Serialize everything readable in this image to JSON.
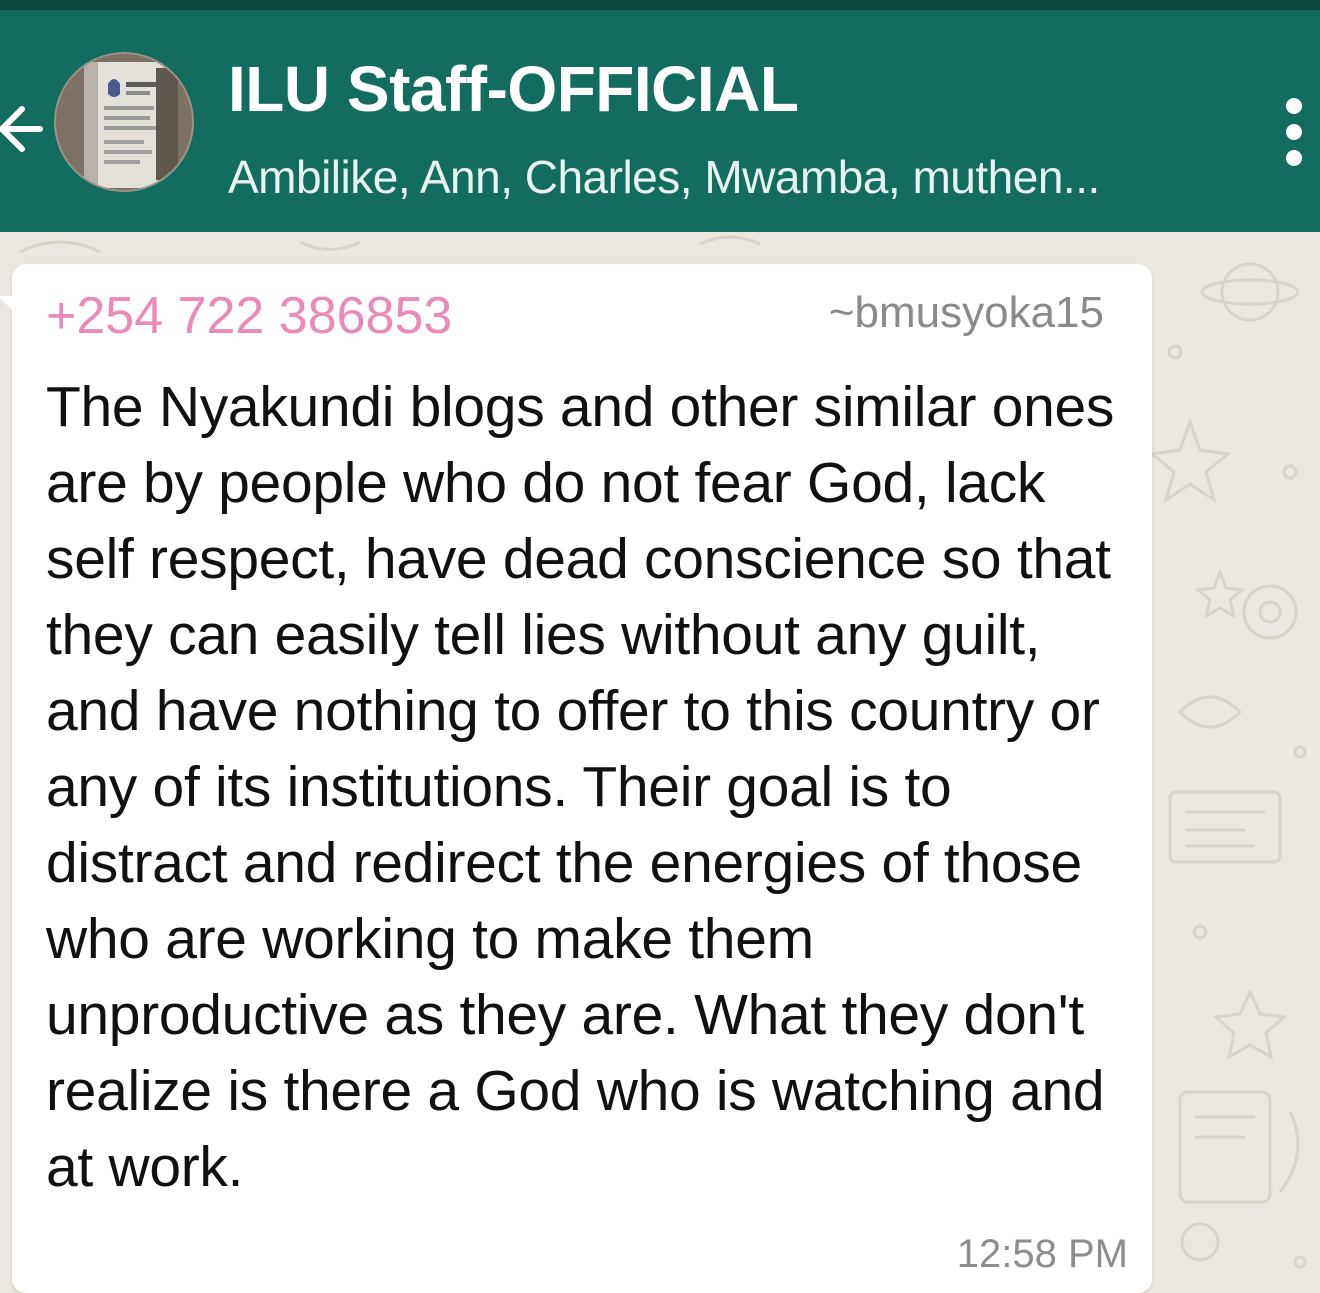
{
  "colors": {
    "header": "#136d5f",
    "status_bar": "#0d4a40",
    "chat_background": "#ebe6df",
    "bubble": "#ffffff",
    "sender_phone": "#e98ab8",
    "timestamp": "#8d8d8d"
  },
  "header": {
    "back_icon": "arrow-back-icon",
    "avatar": "group-avatar",
    "title": "ILU Staff-OFFICIAL",
    "subtitle": "Ambilike, Ann, Charles, Mwamba, muthen...",
    "menu_icon": "more-vert-icon"
  },
  "message": {
    "sender_phone": "+254 722 386853",
    "sender_name": "~bmusyoka15",
    "text": "The Nyakundi blogs and other similar ones are by people who do not fear God, lack self respect, have dead conscience so that they can easily tell lies without any guilt, and have nothing to offer to this country or any of its institutions. Their goal is to distract and redirect the energies of those who are working to make them unproductive as they are. What they don't realize is there a God who is watching and at work.",
    "time": "12:58 PM"
  }
}
